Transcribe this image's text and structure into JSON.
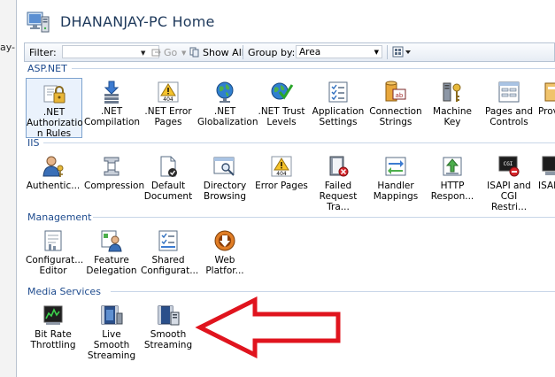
{
  "left_panel": {
    "text": "ay-"
  },
  "header": {
    "title": "DHANANJAY-PC Home"
  },
  "toolbar": {
    "filter_label": "Filter:",
    "go_label": "Go",
    "show_all_label": "Show All",
    "group_by_label": "Group by:",
    "group_by_value": "Area"
  },
  "groups": {
    "aspnet": {
      "title": "ASP.NET",
      "items": [
        {
          "l1": ".NET",
          "l2": "Authorizatio",
          "l3": "n Rules",
          "icon": "lock-icon"
        },
        {
          "l1": ".NET",
          "l2": "Compilation",
          "l3": "",
          "icon": "download-arrow-icon"
        },
        {
          "l1": ".NET Error",
          "l2": "Pages",
          "l3": "",
          "icon": "warning-404-icon"
        },
        {
          "l1": ".NET",
          "l2": "Globalization",
          "l3": "",
          "icon": "globe-icon"
        },
        {
          "l1": ".NET Trust",
          "l2": "Levels",
          "l3": "",
          "icon": "globe-check-icon"
        },
        {
          "l1": "Application",
          "l2": "Settings",
          "l3": "",
          "icon": "checklist-icon"
        },
        {
          "l1": "Connection",
          "l2": "Strings",
          "l3": "",
          "icon": "database-ab-icon"
        },
        {
          "l1": "Machine Key",
          "l2": "",
          "l3": "",
          "icon": "keys-icon"
        },
        {
          "l1": "Pages and",
          "l2": "Controls",
          "l3": "",
          "icon": "form-controls-icon"
        },
        {
          "l1": "Prov",
          "l2": "",
          "l3": "",
          "icon": "provider-icon"
        }
      ]
    },
    "iis": {
      "title": "IIS",
      "items": [
        {
          "l1": "Authentic...",
          "l2": "",
          "l3": "",
          "icon": "user-key-icon"
        },
        {
          "l1": "Compression",
          "l2": "",
          "l3": "",
          "icon": "clamp-icon"
        },
        {
          "l1": "Default",
          "l2": "Document",
          "l3": "",
          "icon": "document-check-icon"
        },
        {
          "l1": "Directory",
          "l2": "Browsing",
          "l3": "",
          "icon": "browser-magnifier-icon"
        },
        {
          "l1": "Error Pages",
          "l2": "",
          "l3": "",
          "icon": "warning-404-icon"
        },
        {
          "l1": "Failed",
          "l2": "Request Tra...",
          "l3": "",
          "icon": "book-error-icon"
        },
        {
          "l1": "Handler",
          "l2": "Mappings",
          "l3": "",
          "icon": "arrows-exchange-icon"
        },
        {
          "l1": "HTTP",
          "l2": "Respon...",
          "l3": "",
          "icon": "http-response-icon"
        },
        {
          "l1": "ISAPI and",
          "l2": "CGI Restri...",
          "l3": "",
          "icon": "cgi-terminal-icon"
        },
        {
          "l1": "ISAPI",
          "l2": "",
          "l3": "",
          "icon": "isapi-icon"
        }
      ]
    },
    "management": {
      "title": "Management",
      "items": [
        {
          "l1": "Configurat...",
          "l2": "Editor",
          "l3": "",
          "icon": "config-editor-icon"
        },
        {
          "l1": "Feature",
          "l2": "Delegation",
          "l3": "",
          "icon": "users-delegation-icon"
        },
        {
          "l1": "Shared",
          "l2": "Configurat...",
          "l3": "",
          "icon": "shared-config-icon"
        },
        {
          "l1": "Web",
          "l2": "Platfor...",
          "l3": "",
          "icon": "web-platform-icon"
        }
      ]
    },
    "media": {
      "title": "Media Services",
      "items": [
        {
          "l1": "Bit Rate",
          "l2": "Throttling",
          "l3": "",
          "icon": "bitrate-graph-icon"
        },
        {
          "l1": "Live Smooth",
          "l2": "Streaming",
          "l3": "",
          "icon": "live-streaming-icon"
        },
        {
          "l1": "Smooth",
          "l2": "Streaming",
          "l3": "",
          "icon": "smooth-streaming-icon"
        }
      ]
    }
  },
  "colors": {
    "group_header": "#1e4b8e",
    "title": "#1e395b",
    "annotation_arrow": "#e0141e"
  }
}
